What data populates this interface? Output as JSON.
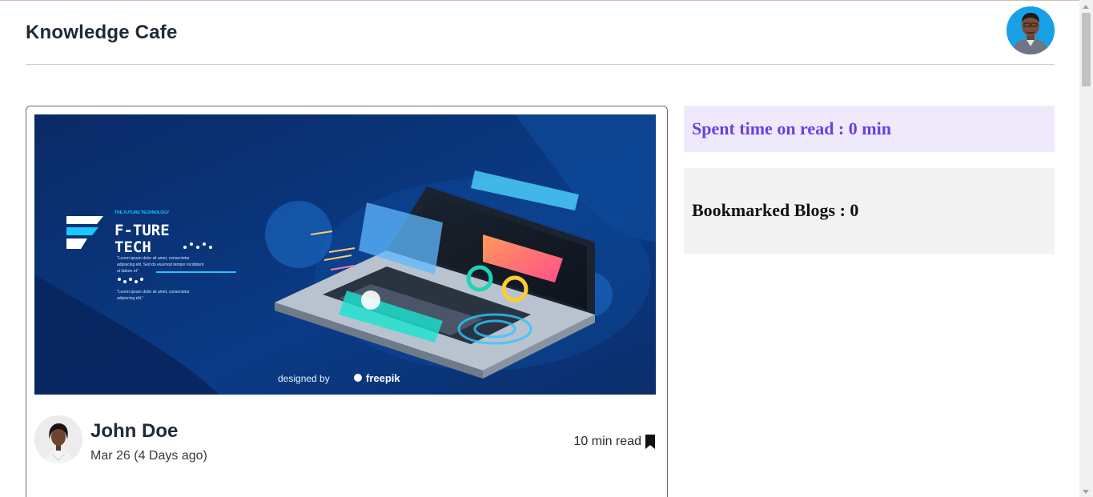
{
  "app": {
    "brand": "Knowledge Cafe"
  },
  "post": {
    "cover": {
      "title_line1": "F-TURE",
      "title_line2": "TECH",
      "tagline": "THE FUTURE TECHNOLOGY",
      "body1": "\"Lorem ipsum dolor sit amet, consectetur adipiscing elit. Sed do eiusmod tempor incididunt ut labore et\"",
      "body2": "\"Lorem ipsum dolor sit amet, consectetur adipiscing elit.\"",
      "credit": "designed by",
      "credit_brand": "freepik"
    },
    "author": "John Doe",
    "date": "Mar 26 (4 Days ago)",
    "read_time": "10 min read"
  },
  "sidebar": {
    "spent_time": "Spent time on read : 0 min",
    "bookmarked": "Bookmarked Blogs : 0"
  },
  "colors": {
    "accent": "#6a3fe0",
    "spent_bg": "#eeeafb",
    "bookmarked_bg": "#f3f3f3"
  },
  "icons": {
    "bookmark": "bookmark-icon"
  }
}
